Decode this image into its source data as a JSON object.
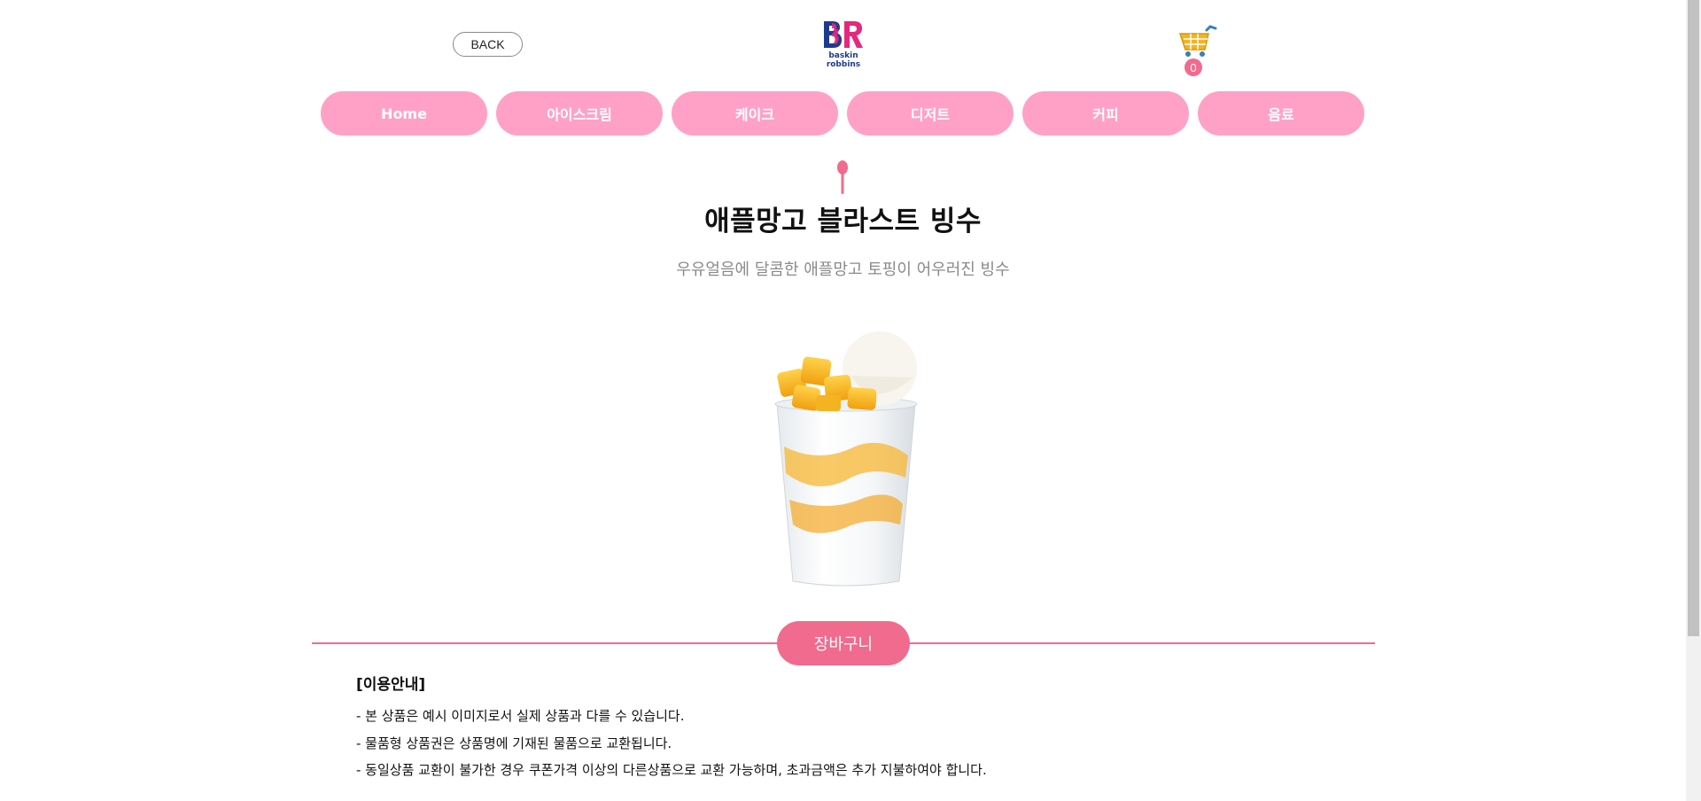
{
  "header": {
    "back_label": "BACK",
    "logo_icon": "baskin-robbins-logo",
    "cart_icon": "shopping-cart-icon",
    "cart_count": "0"
  },
  "nav": {
    "items": [
      {
        "label": "Home"
      },
      {
        "label": "아이스크림"
      },
      {
        "label": "케이크"
      },
      {
        "label": "디저트"
      },
      {
        "label": "커피"
      },
      {
        "label": "음료"
      }
    ]
  },
  "product": {
    "title": "애플망고 블라스트 빙수",
    "description": "우유얼음에 달콤한 애플망고 토핑이 어우러진 빙수",
    "image_icon": "mango-bingsu-cup-image",
    "add_to_cart_label": "장바구니"
  },
  "notice": {
    "title": "[이용안내]",
    "lines": [
      "- 본 상품은 예시 이미지로서 실제 상품과 다를 수 있습니다.",
      "- 물품형 상품권은 상품명에 기재된 물품으로 교환됩니다.",
      "- 동일상품 교환이 불가한 경우 쿠폰가격 이상의 다른상품으로 교환 가능하며, 초과금액은 추가 지불하여야 합니다."
    ]
  },
  "colors": {
    "accent_pink": "#f06b8e",
    "nav_pink": "#ffa1c6",
    "brand_blue": "#1d3b8c",
    "brand_magenta": "#e4287c"
  }
}
